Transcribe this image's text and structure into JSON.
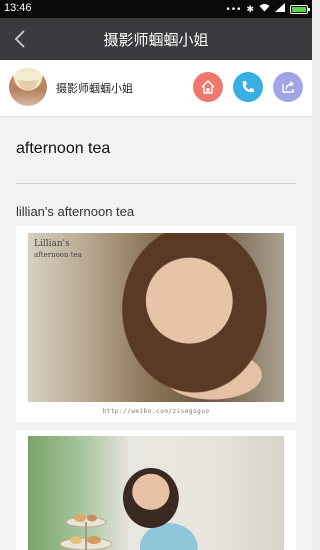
{
  "status_bar": {
    "time": "13:46"
  },
  "nav": {
    "title": "摄影师蝈蝈小姐",
    "back_icon": "chevron-left-icon"
  },
  "profile": {
    "name": "摄影师蝈蝈小姐",
    "buttons": [
      {
        "icon": "home-icon",
        "color": "#f0776b"
      },
      {
        "icon": "phone-icon",
        "color": "#39b0e4"
      },
      {
        "icon": "share-icon",
        "color": "#a3a3e8"
      }
    ]
  },
  "article": {
    "title": "afternoon tea",
    "subtitle": "lillian's afternoon tea",
    "photo1_overlay_line1": "Lillian's",
    "photo1_overlay_line2": "afternoon tea",
    "photo1_caption": "http://weibo.com/zisegoguo"
  },
  "colors": {
    "nav_bg": "#3a3b3f",
    "status_bg": "#0a0a0a"
  }
}
